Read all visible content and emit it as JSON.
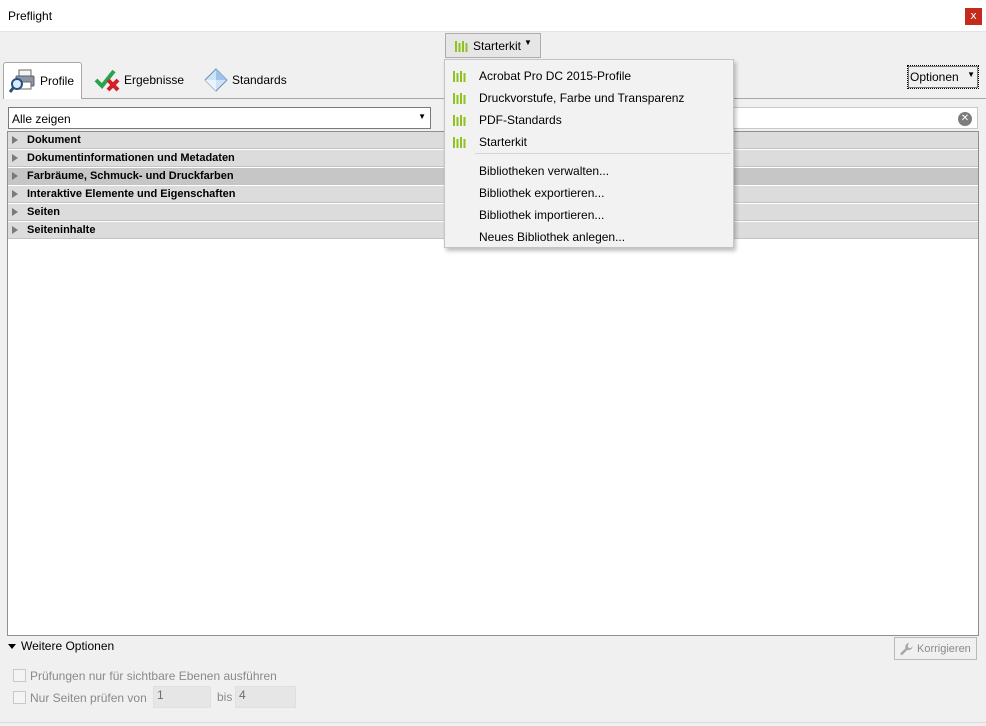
{
  "window": {
    "title": "Preflight",
    "close_label": "x"
  },
  "library_button": {
    "label": "Starterkit",
    "icon": "library-bars-icon"
  },
  "tabs": [
    {
      "label": "Profile",
      "icon": "profile-magnifier-icon",
      "active": true
    },
    {
      "label": "Ergebnisse",
      "icon": "results-check-cross-icon",
      "active": false
    },
    {
      "label": "Standards",
      "icon": "standards-diamond-icon",
      "active": false
    }
  ],
  "options_button": {
    "label": "Optionen"
  },
  "filter": {
    "selected": "Alle zeigen"
  },
  "search": {
    "value": ""
  },
  "tree": [
    {
      "label": "Dokument"
    },
    {
      "label": "Dokumentinformationen und Metadaten"
    },
    {
      "label": "Farbräume, Schmuck- und Druckfarben",
      "selected": true
    },
    {
      "label": "Interaktive Elemente und Eigenschaften"
    },
    {
      "label": "Seiten"
    },
    {
      "label": "Seiteninhalte"
    }
  ],
  "menu": {
    "libraries": [
      {
        "label": "Acrobat Pro DC 2015-Profile"
      },
      {
        "label": "Druckvorstufe, Farbe und Transparenz"
      },
      {
        "label": "PDF-Standards"
      },
      {
        "label": "Starterkit"
      }
    ],
    "actions": [
      {
        "label": "Bibliotheken verwalten..."
      },
      {
        "label": "Bibliothek exportieren..."
      },
      {
        "label": "Bibliothek importieren..."
      },
      {
        "label": "Neues Bibliothek anlegen..."
      }
    ]
  },
  "more_options": {
    "label": "Weitere Optionen"
  },
  "fix_button": {
    "label": "Korrigieren"
  },
  "options": {
    "visible_layers": {
      "label": "Prüfungen nur für sichtbare Ebenen ausführen",
      "checked": false
    },
    "page_range": {
      "label": "Nur Seiten prüfen von",
      "checked": false,
      "from": "1",
      "to_label": "bis",
      "to": "4"
    }
  },
  "colors": {
    "accent_green": "#8dc21f",
    "selection_gray": "#c6c6c6",
    "close_red": "#c42b1c"
  }
}
